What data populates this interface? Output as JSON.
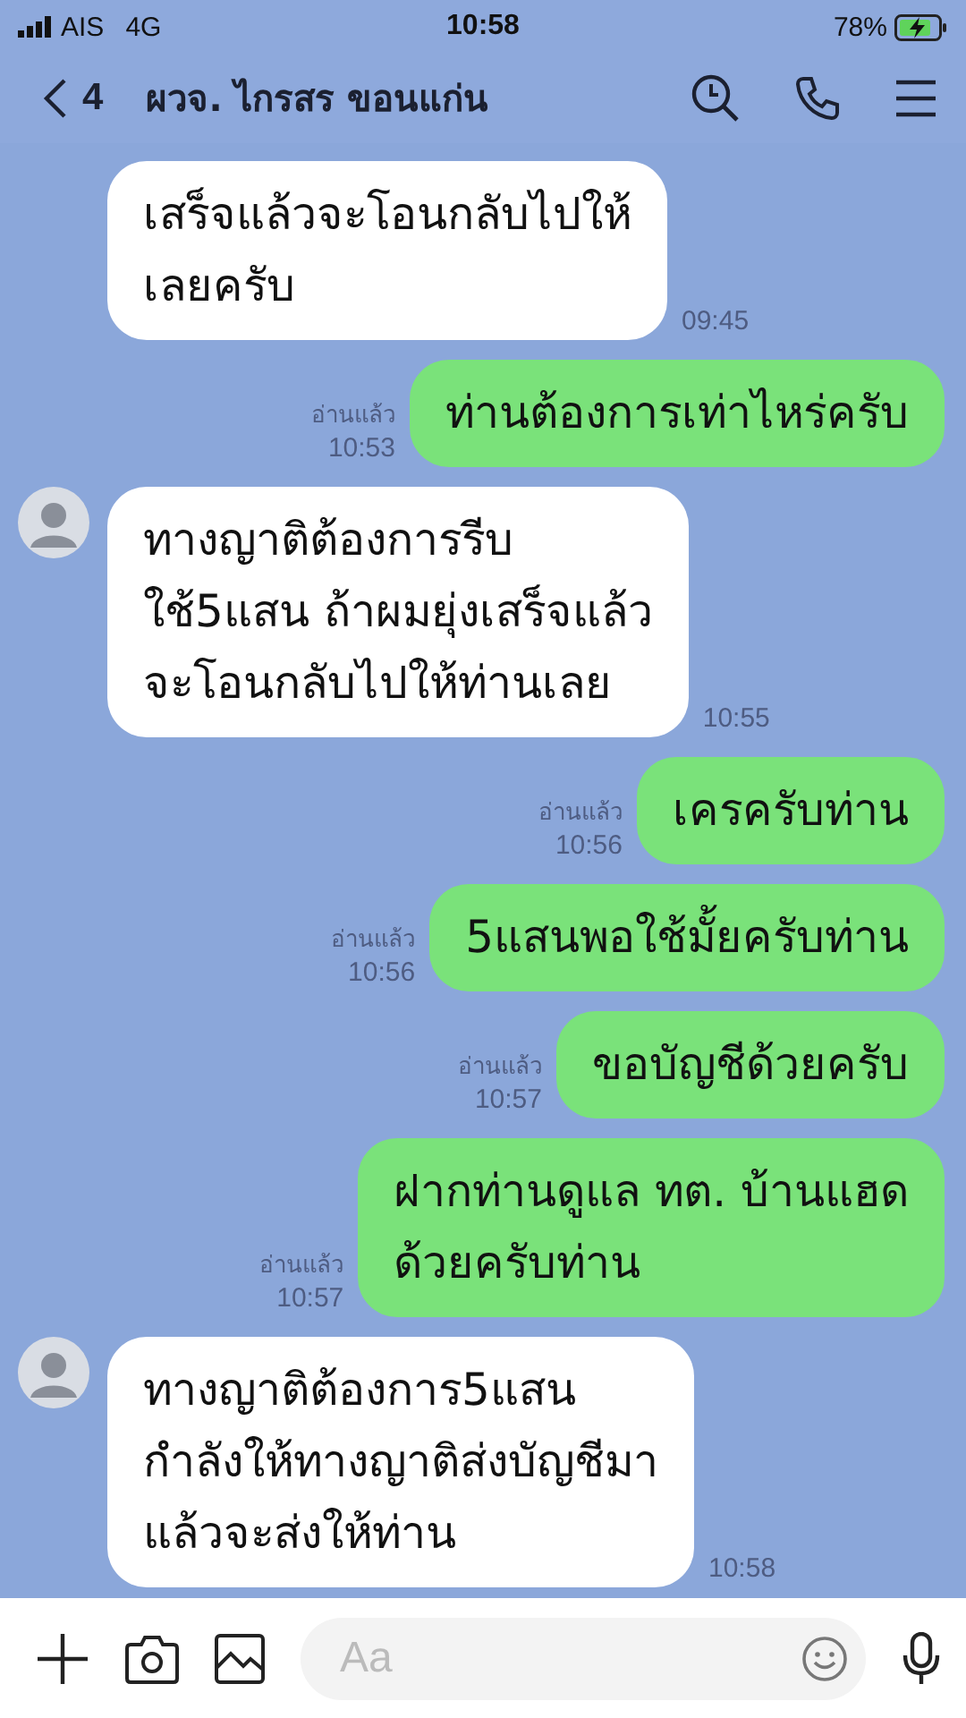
{
  "status_bar": {
    "carrier": "AIS",
    "network": "4G",
    "time": "10:58",
    "battery": "78%"
  },
  "header": {
    "back_count": "4",
    "title": "ผวจ. ไกรสร ขอนแก่น"
  },
  "messages": [
    {
      "kind": "in",
      "avatar": false,
      "text": "เสร็จแล้วจะโอนกลับไปให้\nเลยครับ",
      "time": "09:45"
    },
    {
      "kind": "out",
      "read": "อ่านแล้ว",
      "text": "ท่านต้องการเท่าไหร่ครับ",
      "time": "10:53"
    },
    {
      "kind": "in",
      "avatar": true,
      "text": "ทางญาติต้องการรีบ\nใช้5แสน ถ้าผมยุ่งเสร็จแล้ว\nจะโอนกลับไปให้ท่านเลย",
      "time": "10:55"
    },
    {
      "kind": "out",
      "read": "อ่านแล้ว",
      "text": "เครครับท่าน",
      "time": "10:56"
    },
    {
      "kind": "out",
      "read": "อ่านแล้ว",
      "text": "5แสนพอใช้มั้ยครับท่าน",
      "time": "10:56"
    },
    {
      "kind": "out",
      "read": "อ่านแล้ว",
      "text": "ขอบัญชีด้วยครับ",
      "time": "10:57"
    },
    {
      "kind": "out",
      "read": "อ่านแล้ว",
      "text": "ฝากท่านดูแล ทต. บ้านแฮด\nด้วยครับท่าน",
      "time": "10:57"
    },
    {
      "kind": "in",
      "avatar": true,
      "text": "ทางญาติต้องการ5แสน\nกำลังให้ทางญาติส่งบัญชีมา\nแล้วจะส่งให้ท่าน",
      "time": "10:58"
    }
  ],
  "input": {
    "placeholder": "Aa"
  }
}
